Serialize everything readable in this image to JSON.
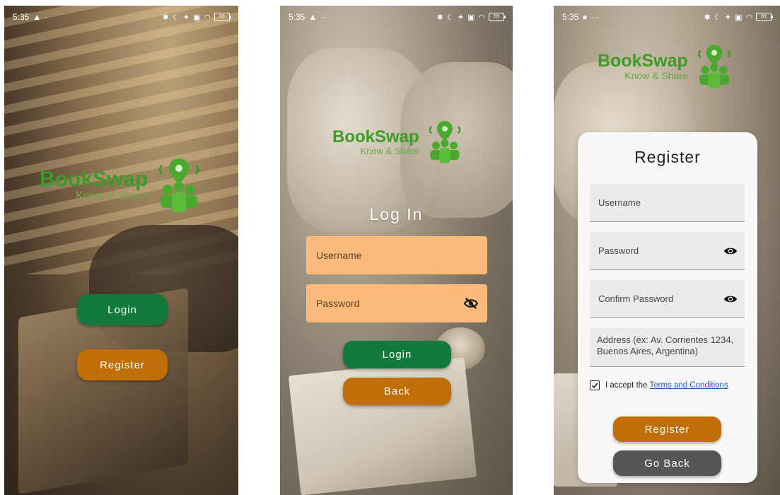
{
  "colors": {
    "brand_green": "#3f9a2a",
    "button_green": "#127a3c",
    "button_orange": "#bf6e08",
    "button_gray": "#565656",
    "field_orange": "#fdbb7b",
    "link_blue": "#1f5fa8"
  },
  "logo": {
    "brand": "BookSwap",
    "tagline": "Know & Share",
    "icon": "location-people-icon"
  },
  "screens": [
    {
      "status": {
        "time": "5:35",
        "battery": "69"
      },
      "buttons": {
        "login": "Login",
        "register": "Register"
      }
    },
    {
      "status": {
        "time": "5:35",
        "battery": "69"
      },
      "title": "Log In",
      "fields": {
        "username_placeholder": "Username",
        "password_placeholder": "Password",
        "password_icon": "eye-off-icon"
      },
      "buttons": {
        "login": "Login",
        "back": "Back"
      }
    },
    {
      "status": {
        "time": "5:35",
        "battery": "69"
      },
      "title": "Register",
      "fields": {
        "username_placeholder": "Username",
        "password_placeholder": "Password",
        "confirm_placeholder": "Confirm Password",
        "address_placeholder": "Address (ex: Av. Corrientes 1234, Buenos Aires, Argentina)",
        "password_icon": "eye-icon"
      },
      "terms": {
        "prefix": "I accept the",
        "link": "Terms and Conditions",
        "checked": true
      },
      "buttons": {
        "register": "Register",
        "go_back": "Go Back"
      }
    }
  ]
}
